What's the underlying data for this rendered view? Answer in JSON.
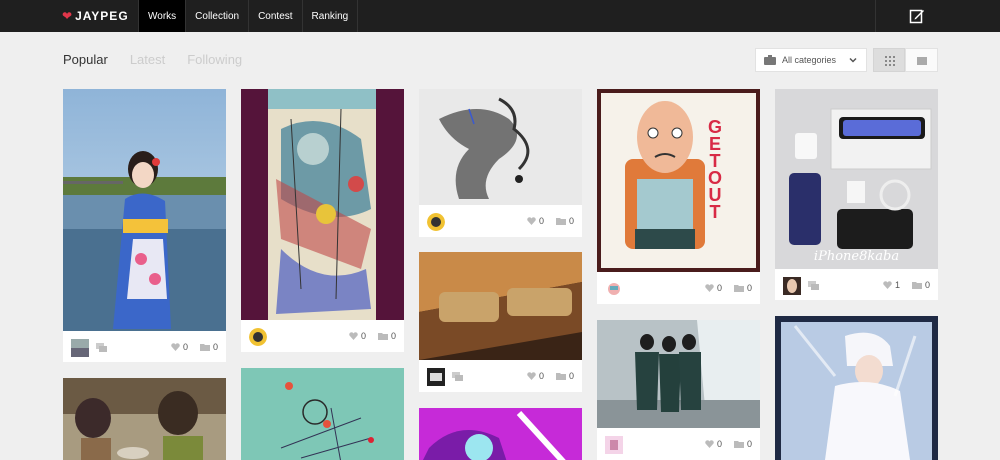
{
  "brand": {
    "name": "JAYPEG"
  },
  "nav": {
    "works": "Works",
    "collection": "Collection",
    "contest": "Contest",
    "ranking": "Ranking"
  },
  "tabs": {
    "popular": "Popular",
    "latest": "Latest",
    "following": "Following"
  },
  "filter": {
    "category": "All categories"
  },
  "icons": {
    "edit": "edit-icon",
    "heart": "heart-icon",
    "folder": "folder-icon",
    "comment": "comment-icon"
  },
  "colors": {
    "topbar": "#1f1f1f",
    "background": "#efefef",
    "brand_heart": "#e0364a"
  },
  "cards": [
    {
      "likes": "0",
      "collects": "0"
    },
    {
      "likes": "0",
      "collects": "0"
    },
    {
      "likes": "0",
      "collects": "0"
    },
    {
      "likes": "0",
      "collects": "0"
    },
    {
      "likes": "0",
      "collects": "0"
    },
    {
      "likes": "0",
      "collects": "0"
    },
    {
      "likes": "1",
      "collects": "0"
    },
    {
      "title": "GET OUT",
      "caption": "iPhone8kaba"
    }
  ]
}
